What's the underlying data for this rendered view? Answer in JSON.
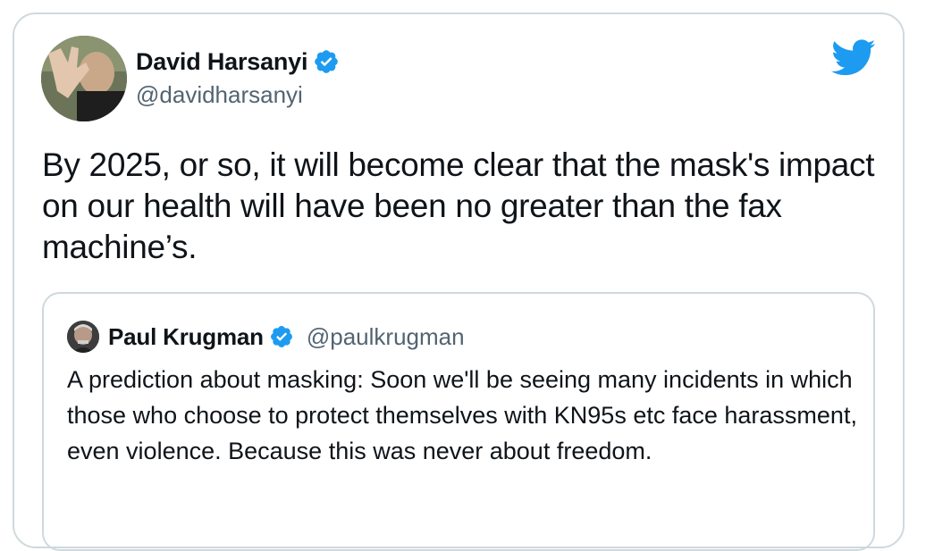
{
  "tweet": {
    "author": {
      "name": "David Harsanyi",
      "handle": "@davidharsanyi",
      "verified": true
    },
    "text": "By 2025, or so, it will become clear that the mask's impact on our health will have been no greater than the fax machine’s.",
    "brand_icon": "twitter-bird-icon",
    "colors": {
      "verified_blue": "#1d9bf0",
      "handle_gray": "#536471",
      "border": "#cfd9de"
    }
  },
  "quoted_tweet": {
    "author": {
      "name": "Paul Krugman",
      "handle": "@paulkrugman",
      "verified": true
    },
    "text": "A prediction about masking: Soon we'll be seeing many incidents in which those who choose to protect themselves with KN95s etc face harassment, even violence. Because this was never about freedom."
  }
}
